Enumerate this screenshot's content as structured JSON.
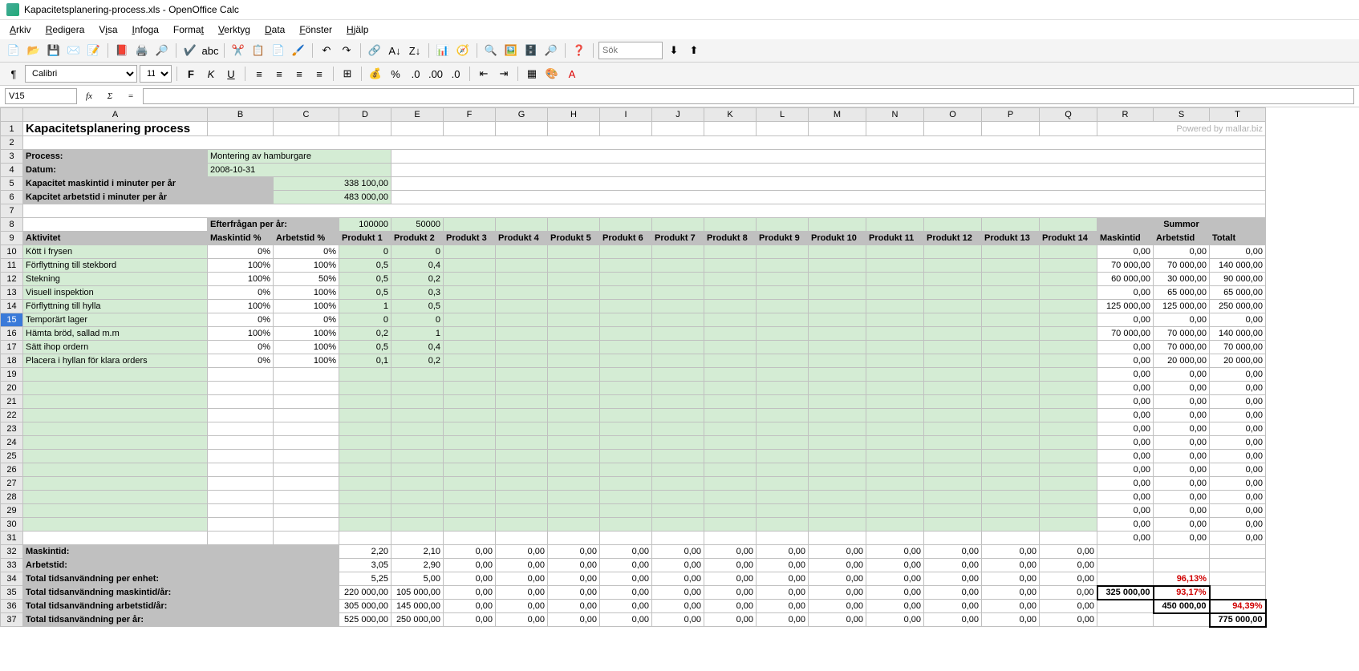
{
  "window": {
    "title": "Kapacitetsplanering-process.xls - OpenOffice Calc"
  },
  "menu": [
    "Arkiv",
    "Redigera",
    "Visa",
    "Infoga",
    "Format",
    "Verktyg",
    "Data",
    "Fönster",
    "Hjälp"
  ],
  "toolbar": {
    "font_name": "Calibri",
    "font_size": "11",
    "search_placeholder": "Sök"
  },
  "formula_bar": {
    "cell_ref": "V15",
    "formula": ""
  },
  "columns": [
    "A",
    "B",
    "C",
    "D",
    "E",
    "F",
    "G",
    "H",
    "I",
    "J",
    "K",
    "L",
    "M",
    "N",
    "O",
    "P",
    "Q",
    "R",
    "S",
    "T"
  ],
  "watermark": "Powered by mallar.biz",
  "header": {
    "title": "Kapacitetsplanering process",
    "process_label": "Process:",
    "process_value": "Montering av hamburgare",
    "datum_label": "Datum:",
    "datum_value": "2008-10-31",
    "kap_mask_label": "Kapacitet maskintid i minuter per år",
    "kap_mask_value": "338 100,00",
    "kap_arb_label": "Kapcitet arbetstid i minuter per år",
    "kap_arb_value": "483 000,00"
  },
  "table_header": {
    "efterfragan": "Efterfrågan per år:",
    "d8": "100000",
    "e8": "50000",
    "aktivitet": "Aktivitet",
    "maskintid_pct": "Maskintid %",
    "arbetstid_pct": "Arbetstid %",
    "products": [
      "Produkt 1",
      "Produkt 2",
      "Produkt 3",
      "Produkt 4",
      "Produkt 5",
      "Produkt 6",
      "Produkt 7",
      "Produkt 8",
      "Produkt 9",
      "Produkt 10",
      "Produkt 11",
      "Produkt 12",
      "Produkt 13",
      "Produkt 14"
    ],
    "summor": "Summor",
    "maskintid": "Maskintid",
    "arbetstid": "Arbetstid",
    "totalt": "Totalt"
  },
  "rows": [
    {
      "n": 10,
      "a": "Kött i frysen",
      "b": "0%",
      "c": "0%",
      "d": "0",
      "e": "0",
      "r": "0,00",
      "s": "0,00",
      "t": "0,00"
    },
    {
      "n": 11,
      "a": "Förflyttning till stekbord",
      "b": "100%",
      "c": "100%",
      "d": "0,5",
      "e": "0,4",
      "r": "70 000,00",
      "s": "70 000,00",
      "t": "140 000,00"
    },
    {
      "n": 12,
      "a": "Stekning",
      "b": "100%",
      "c": "50%",
      "d": "0,5",
      "e": "0,2",
      "r": "60 000,00",
      "s": "30 000,00",
      "t": "90 000,00"
    },
    {
      "n": 13,
      "a": "Visuell inspektion",
      "b": "0%",
      "c": "100%",
      "d": "0,5",
      "e": "0,3",
      "r": "0,00",
      "s": "65 000,00",
      "t": "65 000,00"
    },
    {
      "n": 14,
      "a": "Förflyttning till hylla",
      "b": "100%",
      "c": "100%",
      "d": "1",
      "e": "0,5",
      "r": "125 000,00",
      "s": "125 000,00",
      "t": "250 000,00"
    },
    {
      "n": 15,
      "a": "Temporärt lager",
      "b": "0%",
      "c": "0%",
      "d": "0",
      "e": "0",
      "r": "0,00",
      "s": "0,00",
      "t": "0,00",
      "sel": true
    },
    {
      "n": 16,
      "a": "Hämta bröd, sallad m.m",
      "b": "100%",
      "c": "100%",
      "d": "0,2",
      "e": "1",
      "r": "70 000,00",
      "s": "70 000,00",
      "t": "140 000,00"
    },
    {
      "n": 17,
      "a": "Sätt ihop ordern",
      "b": "0%",
      "c": "100%",
      "d": "0,5",
      "e": "0,4",
      "r": "0,00",
      "s": "70 000,00",
      "t": "70 000,00"
    },
    {
      "n": 18,
      "a": "Placera i hyllan för klara orders",
      "b": "0%",
      "c": "100%",
      "d": "0,1",
      "e": "0,2",
      "r": "0,00",
      "s": "20 000,00",
      "t": "20 000,00"
    },
    {
      "n": 19,
      "r": "0,00",
      "s": "0,00",
      "t": "0,00"
    },
    {
      "n": 20,
      "r": "0,00",
      "s": "0,00",
      "t": "0,00"
    },
    {
      "n": 21,
      "r": "0,00",
      "s": "0,00",
      "t": "0,00"
    },
    {
      "n": 22,
      "r": "0,00",
      "s": "0,00",
      "t": "0,00"
    },
    {
      "n": 23,
      "r": "0,00",
      "s": "0,00",
      "t": "0,00"
    },
    {
      "n": 24,
      "r": "0,00",
      "s": "0,00",
      "t": "0,00"
    },
    {
      "n": 25,
      "r": "0,00",
      "s": "0,00",
      "t": "0,00"
    },
    {
      "n": 26,
      "r": "0,00",
      "s": "0,00",
      "t": "0,00"
    },
    {
      "n": 27,
      "r": "0,00",
      "s": "0,00",
      "t": "0,00"
    },
    {
      "n": 28,
      "r": "0,00",
      "s": "0,00",
      "t": "0,00"
    },
    {
      "n": 29,
      "r": "0,00",
      "s": "0,00",
      "t": "0,00"
    },
    {
      "n": 30,
      "r": "0,00",
      "s": "0,00",
      "t": "0,00"
    }
  ],
  "summary": {
    "r31": {
      "n": 31,
      "r": "0,00",
      "s": "0,00",
      "t": "0,00"
    },
    "r32": {
      "n": 32,
      "a": "Maskintid:",
      "vals": [
        "2,20",
        "2,10",
        "0,00",
        "0,00",
        "0,00",
        "0,00",
        "0,00",
        "0,00",
        "0,00",
        "0,00",
        "0,00",
        "0,00",
        "0,00",
        "0,00"
      ]
    },
    "r33": {
      "n": 33,
      "a": "Arbetstid:",
      "vals": [
        "3,05",
        "2,90",
        "0,00",
        "0,00",
        "0,00",
        "0,00",
        "0,00",
        "0,00",
        "0,00",
        "0,00",
        "0,00",
        "0,00",
        "0,00",
        "0,00"
      ]
    },
    "r34": {
      "n": 34,
      "a": "Total tidsanvändning per enhet:",
      "vals": [
        "5,25",
        "5,00",
        "0,00",
        "0,00",
        "0,00",
        "0,00",
        "0,00",
        "0,00",
        "0,00",
        "0,00",
        "0,00",
        "0,00",
        "0,00",
        "0,00"
      ],
      "s": "96,13%"
    },
    "r35": {
      "n": 35,
      "a": "Total tidsanvändning maskintid/år:",
      "vals": [
        "220 000,00",
        "105 000,00",
        "0,00",
        "0,00",
        "0,00",
        "0,00",
        "0,00",
        "0,00",
        "0,00",
        "0,00",
        "0,00",
        "0,00",
        "0,00",
        "0,00"
      ],
      "r": "325 000,00",
      "s": "93,17%"
    },
    "r36": {
      "n": 36,
      "a": "Total tidsanvändning arbetstid/år:",
      "vals": [
        "305 000,00",
        "145 000,00",
        "0,00",
        "0,00",
        "0,00",
        "0,00",
        "0,00",
        "0,00",
        "0,00",
        "0,00",
        "0,00",
        "0,00",
        "0,00",
        "0,00"
      ],
      "s": "450 000,00",
      "t": "94,39%"
    },
    "r37": {
      "n": 37,
      "a": "Total tidsanvändning per år:",
      "vals": [
        "525 000,00",
        "250 000,00",
        "0,00",
        "0,00",
        "0,00",
        "0,00",
        "0,00",
        "0,00",
        "0,00",
        "0,00",
        "0,00",
        "0,00",
        "0,00",
        "0,00"
      ],
      "t": "775 000,00"
    }
  }
}
